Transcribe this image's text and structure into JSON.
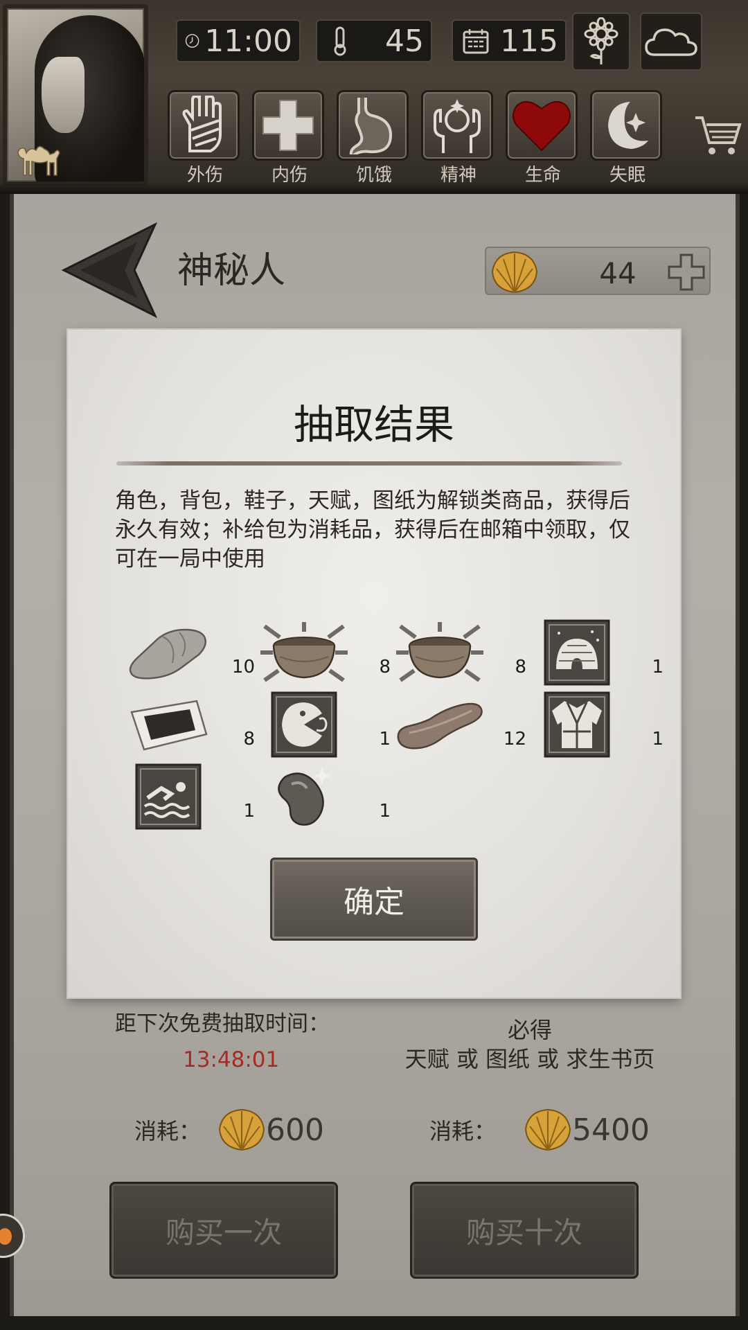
{
  "hud": {
    "time": "11:00",
    "temperature": "45",
    "day": "115",
    "statuses": [
      {
        "label": "外伤",
        "icon": "hand-bandage-icon"
      },
      {
        "label": "内伤",
        "icon": "cross-icon"
      },
      {
        "label": "饥饿",
        "icon": "stomach-icon"
      },
      {
        "label": "精神",
        "icon": "mind-icon"
      },
      {
        "label": "生命",
        "icon": "heart-icon"
      },
      {
        "label": "失眠",
        "icon": "moon-star-icon"
      }
    ]
  },
  "page": {
    "title": "神秘人",
    "shells": "44"
  },
  "dialog": {
    "title": "抽取结果",
    "description": "角色，背包，鞋子，天赋，图纸为解锁类商品，获得后永久有效；补给包为消耗品，获得后在邮箱中领取，仅可在一局中使用",
    "items": [
      {
        "icon": "stone-icon",
        "qty": "10"
      },
      {
        "icon": "bowl-icon",
        "qty": "8"
      },
      {
        "icon": "bowl-icon",
        "qty": "8"
      },
      {
        "icon": "igloo-talent-icon",
        "qty": "1"
      },
      {
        "icon": "tar-paper-icon",
        "qty": "8"
      },
      {
        "icon": "pacman-talent-icon",
        "qty": "1"
      },
      {
        "icon": "dried-meat-icon",
        "qty": "12"
      },
      {
        "icon": "robe-talent-icon",
        "qty": "1"
      },
      {
        "icon": "swim-talent-icon",
        "qty": "1"
      },
      {
        "icon": "bean-icon",
        "qty": "1"
      }
    ],
    "confirm": "确定"
  },
  "shop": {
    "next_free_label": "距下次免费抽取时间：",
    "timer": "13:48:01",
    "guarantee_title": "必得",
    "guarantee_text": "天赋 或 图纸 或 求生书页",
    "cost_label": "消耗：",
    "cost_single": "600",
    "cost_ten": "5400",
    "buy_once": "购买一次",
    "buy_ten": "购买十次"
  },
  "colors": {
    "timer_red": "#a42c23",
    "heart_red": "#8e0a0a",
    "shell_gold": "#d8a23a"
  }
}
